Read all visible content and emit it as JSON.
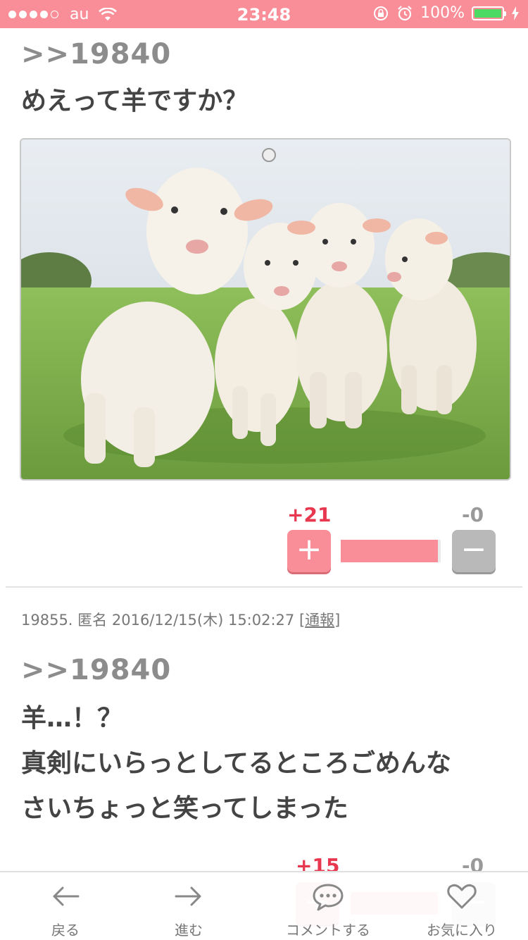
{
  "status_bar": {
    "carrier": "au",
    "time": "23:48",
    "battery": "100%"
  },
  "posts": [
    {
      "anchor": ">>19840",
      "lines": [
        "めえって羊ですか？"
      ],
      "plus_votes": "+21",
      "minus_votes": "-0",
      "plus_button": "+",
      "minus_button": "−"
    },
    {
      "meta_number": "19855.",
      "meta_name": "匿名",
      "meta_datetime": "2016/12/15(木) 15:02:27",
      "report_label": "通報",
      "anchor": ">>19840",
      "lines": [
        "羊…！？",
        "真剣にいらっとしてるところごめんな",
        "さいちょっと笑ってしまった"
      ],
      "plus_votes": "+15",
      "minus_votes": "-0"
    }
  ],
  "toolbar": {
    "back": "戻る",
    "forward": "進む",
    "comment": "コメントする",
    "favorite": "お気に入り"
  },
  "colors": {
    "accent": "#f98e98",
    "plus_text": "#e8384f",
    "battery_green": "#4cd964"
  }
}
